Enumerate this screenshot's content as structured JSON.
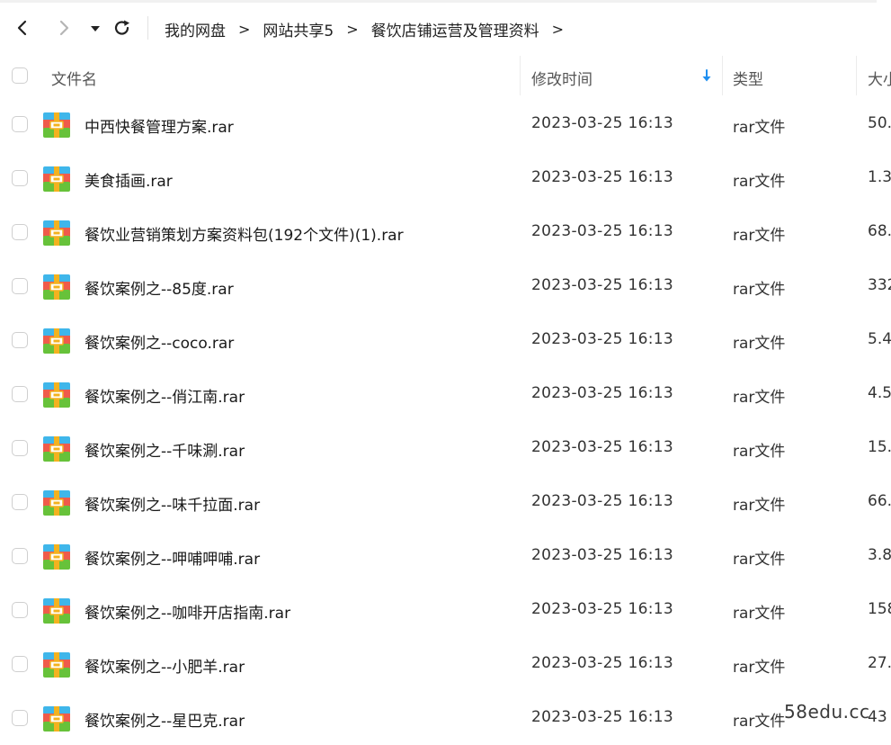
{
  "breadcrumb": {
    "items": [
      "我的网盘",
      "网站共享5",
      "餐饮店铺运营及管理资料"
    ],
    "separator": ">"
  },
  "columns": {
    "name": "文件名",
    "modified": "修改时间",
    "type": "类型",
    "size": "大小"
  },
  "sort": {
    "column": "修改时间",
    "direction": "descending",
    "arrow_color": "#1f8ff0"
  },
  "files": [
    {
      "name": "中西快餐管理方案.rar",
      "modified": "2023-03-25 16:13",
      "type": "rar文件",
      "size": "50."
    },
    {
      "name": "美食插画.rar",
      "modified": "2023-03-25 16:13",
      "type": "rar文件",
      "size": "1.3"
    },
    {
      "name": "餐饮业营销策划方案资料包(192个文件)(1).rar",
      "modified": "2023-03-25 16:13",
      "type": "rar文件",
      "size": "68."
    },
    {
      "name": "餐饮案例之--85度.rar",
      "modified": "2023-03-25 16:13",
      "type": "rar文件",
      "size": "332"
    },
    {
      "name": "餐饮案例之--coco.rar",
      "modified": "2023-03-25 16:13",
      "type": "rar文件",
      "size": "5.4"
    },
    {
      "name": "餐饮案例之--俏江南.rar",
      "modified": "2023-03-25 16:13",
      "type": "rar文件",
      "size": "4.5"
    },
    {
      "name": "餐饮案例之--千味涮.rar",
      "modified": "2023-03-25 16:13",
      "type": "rar文件",
      "size": "15."
    },
    {
      "name": "餐饮案例之--味千拉面.rar",
      "modified": "2023-03-25 16:13",
      "type": "rar文件",
      "size": "66."
    },
    {
      "name": "餐饮案例之--呷哺呷哺.rar",
      "modified": "2023-03-25 16:13",
      "type": "rar文件",
      "size": "3.8"
    },
    {
      "name": "餐饮案例之--咖啡开店指南.rar",
      "modified": "2023-03-25 16:13",
      "type": "rar文件",
      "size": "158"
    },
    {
      "name": "餐饮案例之--小肥羊.rar",
      "modified": "2023-03-25 16:13",
      "type": "rar文件",
      "size": "27."
    },
    {
      "name": "餐饮案例之--星巴克.rar",
      "modified": "2023-03-25 16:13",
      "type": "rar文件",
      "size": "43"
    }
  ],
  "watermark": "58edu.cc",
  "icons": {
    "back": "chevron-left-icon",
    "forward": "chevron-right-icon",
    "history": "caret-down-icon",
    "refresh": "refresh-icon",
    "file": "rar-archive-icon"
  }
}
